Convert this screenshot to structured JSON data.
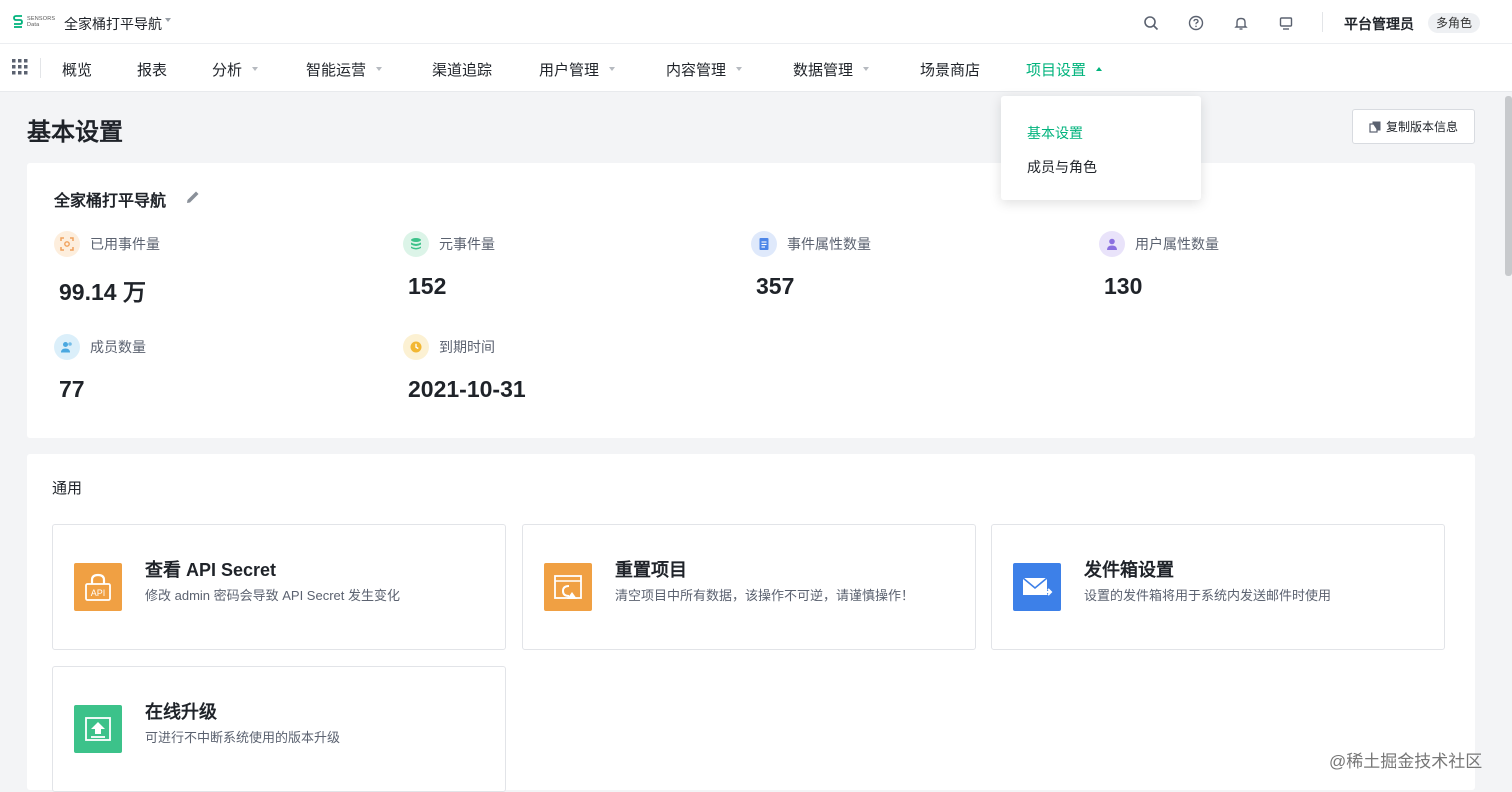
{
  "app": {
    "logo_text_line1": "SENSORS",
    "logo_text_line2": "Data",
    "project_name": "全家桶打平导航",
    "user_name": "平台管理员",
    "role_badge": "多角色",
    "brand_color": "#00b37c"
  },
  "top_icons": [
    "search-icon",
    "help-icon",
    "bell-icon",
    "monitor-icon"
  ],
  "nav": {
    "items": [
      {
        "label": "概览",
        "has_caret": false
      },
      {
        "label": "报表",
        "has_caret": false
      },
      {
        "label": "分析",
        "has_caret": true
      },
      {
        "label": "智能运营",
        "has_caret": true
      },
      {
        "label": "渠道追踪",
        "has_caret": false
      },
      {
        "label": "用户管理",
        "has_caret": true
      },
      {
        "label": "内容管理",
        "has_caret": true
      },
      {
        "label": "数据管理",
        "has_caret": true
      },
      {
        "label": "场景商店",
        "has_caret": false
      },
      {
        "label": "项目设置",
        "has_caret": true,
        "active": true
      }
    ]
  },
  "dropdown": {
    "items": [
      {
        "label": "基本设置",
        "active": true
      },
      {
        "label": "成员与角色",
        "active": false
      }
    ]
  },
  "page": {
    "title": "基本设置",
    "copy_button": "复制版本信息"
  },
  "project_card": {
    "title": "全家桶打平导航",
    "stats": [
      {
        "label": "已用事件量",
        "value": "99.14 万",
        "icon": "scan-icon",
        "color": "#f0a15c"
      },
      {
        "label": "元事件量",
        "value": "152",
        "icon": "database-icon",
        "color": "#3cc28a"
      },
      {
        "label": "事件属性数量",
        "value": "357",
        "icon": "document-icon",
        "color": "#4d86e8"
      },
      {
        "label": "用户属性数量",
        "value": "130",
        "icon": "user-icon",
        "color": "#8a6fe0"
      },
      {
        "label": "成员数量",
        "value": "77",
        "icon": "members-icon",
        "color": "#4aa8e0"
      },
      {
        "label": "到期时间",
        "value": "2021-10-31",
        "icon": "clock-icon",
        "color": "#f2b733"
      }
    ]
  },
  "general": {
    "title": "通用",
    "tiles": [
      {
        "title": "查看 API Secret",
        "desc": "修改 admin 密码会导致 API Secret 发生变化",
        "icon": "api-lock-icon",
        "color": "#f0a043",
        "icon_text": "API"
      },
      {
        "title": "重置项目",
        "desc": "清空项目中所有数据，该操作不可逆，请谨慎操作！",
        "icon": "reset-icon",
        "color": "#f0a043"
      },
      {
        "title": "发件箱设置",
        "desc": "设置的发件箱将用于系统内发送邮件时使用",
        "icon": "mail-icon",
        "color": "#3d80e8"
      },
      {
        "title": "在线升级",
        "desc": "可进行不中断系统使用的版本升级",
        "icon": "upgrade-icon",
        "color": "#3cc28a"
      }
    ]
  },
  "watermark": "@稀土掘金技术社区"
}
